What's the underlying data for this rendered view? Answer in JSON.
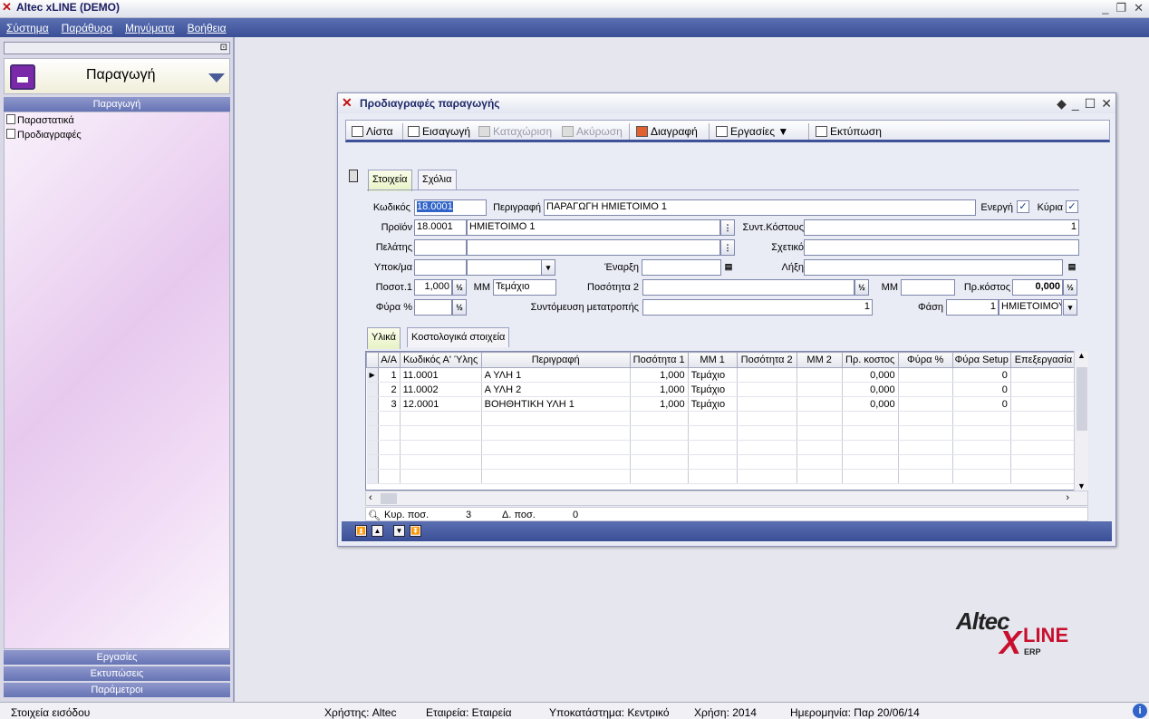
{
  "app": {
    "title": "Altec xLINE (DEMO)"
  },
  "menu": [
    "Σύστημα",
    "Παράθυρα",
    "Μηνύματα",
    "Βοήθεια"
  ],
  "sidebar": {
    "header": "Παραγωγή",
    "section_active": "Παραγωγή",
    "items": [
      "Παραστατικά",
      "Προδιαγραφές"
    ],
    "bottom_sections": [
      "Εργασίες",
      "Εκτυπώσεις",
      "Παράμετροι"
    ]
  },
  "window": {
    "title": "Προδιαγραφές παραγωγής",
    "toolbar": {
      "list": "Λίστα",
      "insert": "Εισαγωγή",
      "save": "Καταχώριση",
      "cancel": "Ακύρωση",
      "delete": "Διαγραφή",
      "tasks": "Εργασίες",
      "print": "Εκτύπωση"
    },
    "tabs": [
      "Στοιχεία",
      "Σχόλια"
    ],
    "form": {
      "code_label": "Κωδικός",
      "code": "18.0001",
      "desc_label": "Περιγραφή",
      "desc": "ΠΑΡΑΓΩΓΗ ΗΜΙΕΤΟΙΜΟ 1",
      "active_label": "Ενεργή",
      "main_label": "Κύρια",
      "product_label": "Προϊόν",
      "product_code": "18.0001",
      "product_name": "ΗΜΙΕΤΟΙΜΟ 1",
      "costfactor_label": "Συντ.Κόστους",
      "costfactor": "1",
      "customer_label": "Πελάτης",
      "related_label": "Σχετικό",
      "model_label": "Υποκ/μα",
      "start_label": "Έναρξη",
      "end_label": "Λήξη",
      "qty1_label": "Ποσοτ.1",
      "qty1": "1,000",
      "mm_label": "ΜΜ",
      "mm": "Τεμάχιο",
      "qty2_label": "Ποσότητα 2",
      "mm2_label": "ΜΜ",
      "precost_label": "Πρ.κόστος",
      "precost": "0,000",
      "waste_label": "Φύρα %",
      "conv_label": "Συντόμευση μετατροπής",
      "conv": "1",
      "phase_label": "Φάση",
      "phase_no": "1",
      "phase_name": "ΗΜΙΕΤΟΙΜΟΥ"
    },
    "subtabs": [
      "Υλικά",
      "Κοστολογικά στοιχεία"
    ],
    "grid": {
      "columns": [
        "Α/Α",
        "Κωδικός Α' Ύλης",
        "Περιγραφή",
        "Ποσότητα 1",
        "ΜΜ 1",
        "Ποσότητα 2",
        "ΜΜ 2",
        "Πρ. κοστος",
        "Φύρα %",
        "Φύρα Setup",
        "Επεξεργασία"
      ],
      "rows": [
        [
          "1",
          "11.0001",
          "Α ΥΛΗ 1",
          "1,000",
          "Τεμάχιο",
          "",
          "",
          "0,000",
          "",
          "0",
          ""
        ],
        [
          "2",
          "11.0002",
          "Α ΥΛΗ 2",
          "1,000",
          "Τεμάχιο",
          "",
          "",
          "0,000",
          "",
          "0",
          ""
        ],
        [
          "3",
          "12.0001",
          "ΒΟΗΘΗΤΙΚΗ ΥΛΗ 1",
          "1,000",
          "Τεμάχιο",
          "",
          "",
          "0,000",
          "",
          "0",
          ""
        ]
      ]
    },
    "summary": {
      "cur_label": "Κυρ. ποσ.",
      "cur": "3",
      "d_label": "Δ. ποσ.",
      "d": "0"
    }
  },
  "logo": {
    "brand": "Altec",
    "x": "X",
    "line": "LINE",
    "erp": "ERP"
  },
  "status": {
    "left": "Στοιχεία εισόδου",
    "user": "Χρήστης: Altec",
    "company": "Εταιρεία: Εταιρεία",
    "branch": "Υποκατάστημα: Κεντρικό",
    "year": "Χρήση: 2014",
    "date": "Ημερομηνία: Παρ 20/06/14"
  }
}
